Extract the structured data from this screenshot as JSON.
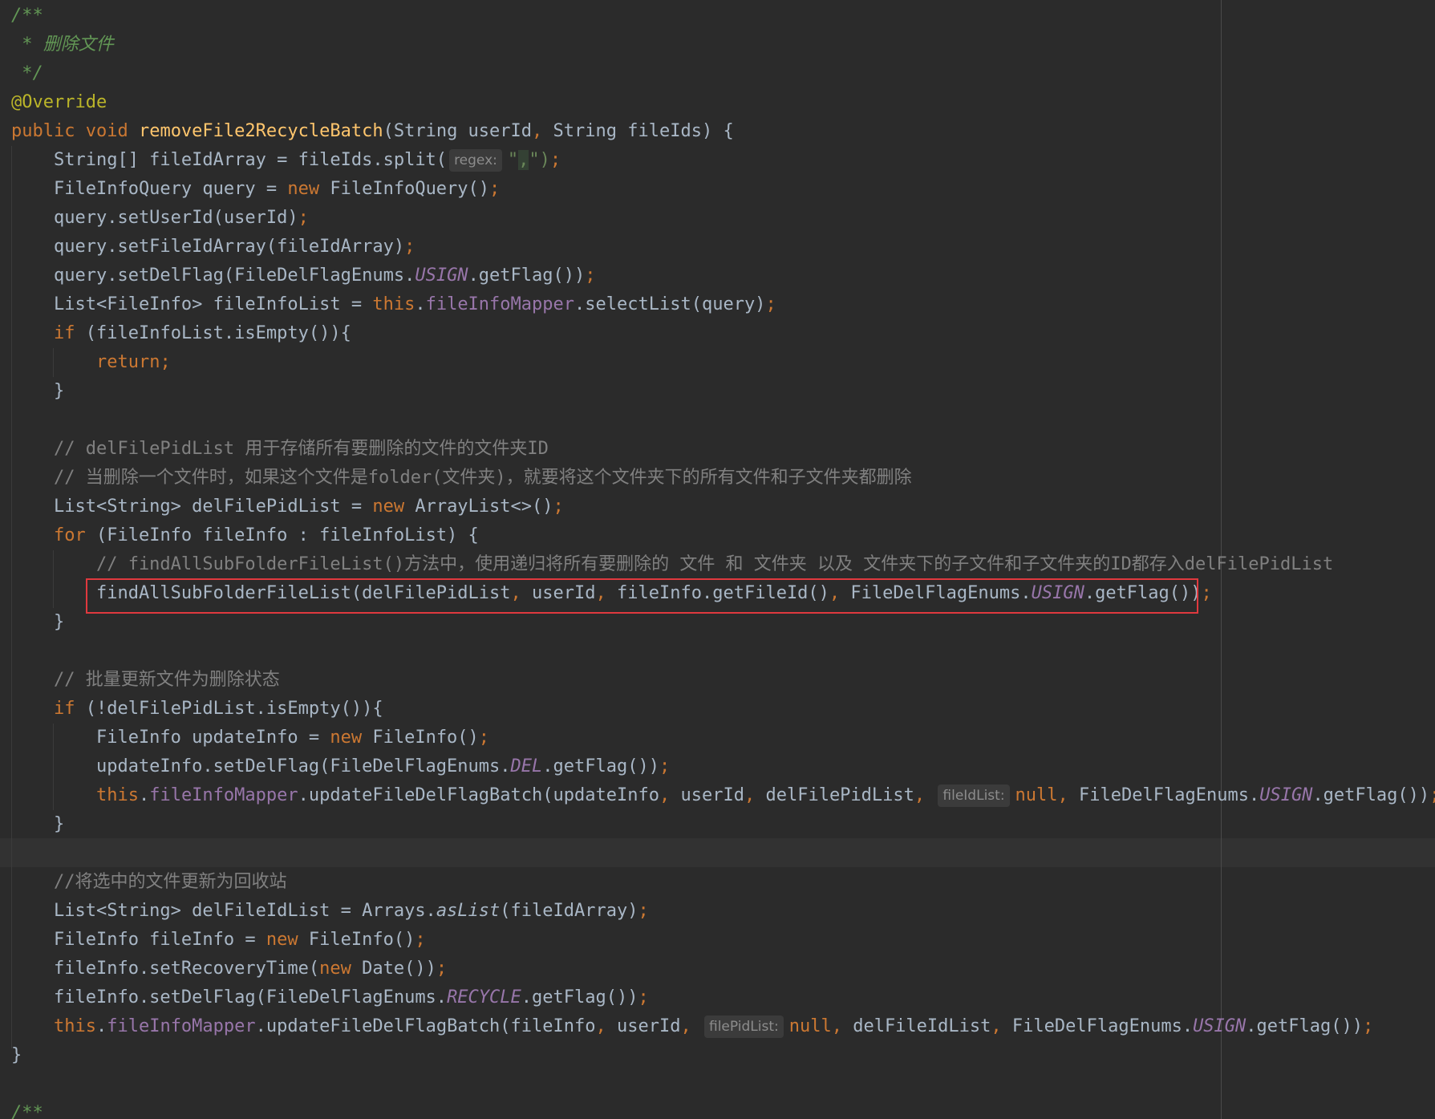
{
  "editor": {
    "highlighted_line_index": 20,
    "lines": [
      [
        {
          "t": "/**",
          "k": "doc"
        }
      ],
      [
        {
          "t": " * 删除文件",
          "k": "doc"
        }
      ],
      [
        {
          "t": " */",
          "k": "doc"
        }
      ],
      [
        {
          "t": "@Override",
          "k": "ann"
        }
      ],
      [
        {
          "t": "public void ",
          "k": "kw"
        },
        {
          "t": "removeFile2RecycleBatch",
          "k": "fn"
        },
        {
          "t": "(String userId",
          "k": "plain"
        },
        {
          "t": ", ",
          "k": "punct"
        },
        {
          "t": "String fileIds) {",
          "k": "plain"
        }
      ],
      [
        {
          "t": "    String[] fileIdArray = fileIds.split(",
          "k": "plain"
        },
        {
          "t": "regex:",
          "k": "hint"
        },
        {
          "t": "\"",
          "k": "str"
        },
        {
          "t": ",",
          "k": "str_hl"
        },
        {
          "t": "\")",
          "k": "str"
        },
        {
          "t": ";",
          "k": "punct"
        }
      ],
      [
        {
          "t": "    FileInfoQuery query = ",
          "k": "plain"
        },
        {
          "t": "new ",
          "k": "kw"
        },
        {
          "t": "FileInfoQuery()",
          "k": "plain"
        },
        {
          "t": ";",
          "k": "punct"
        }
      ],
      [
        {
          "t": "    query.setUserId(userId)",
          "k": "plain"
        },
        {
          "t": ";",
          "k": "punct"
        }
      ],
      [
        {
          "t": "    query.setFileIdArray(fileIdArray)",
          "k": "plain"
        },
        {
          "t": ";",
          "k": "punct"
        }
      ],
      [
        {
          "t": "    query.setDelFlag(FileDelFlagEnums.",
          "k": "plain"
        },
        {
          "t": "USIGN",
          "k": "const"
        },
        {
          "t": ".getFlag())",
          "k": "plain"
        },
        {
          "t": ";",
          "k": "punct"
        }
      ],
      [
        {
          "t": "    List<FileInfo> fileInfoList = ",
          "k": "plain"
        },
        {
          "t": "this",
          "k": "kw"
        },
        {
          "t": ".",
          "k": "plain"
        },
        {
          "t": "fileInfoMapper",
          "k": "field"
        },
        {
          "t": ".selectList(query)",
          "k": "plain"
        },
        {
          "t": ";",
          "k": "punct"
        }
      ],
      [
        {
          "t": "    ",
          "k": "plain"
        },
        {
          "t": "if ",
          "k": "kw"
        },
        {
          "t": "(fileInfoList.isEmpty()){",
          "k": "plain"
        }
      ],
      [
        {
          "t": "        ",
          "k": "plain"
        },
        {
          "t": "return;",
          "k": "kw"
        }
      ],
      [
        {
          "t": "    }",
          "k": "plain"
        }
      ],
      [
        {
          "t": "",
          "k": "plain"
        }
      ],
      [
        {
          "t": "    // delFilePidList 用于存储所有要删除的文件的文件夹ID",
          "k": "comment"
        }
      ],
      [
        {
          "t": "    // 当删除一个文件时，如果这个文件是folder(文件夹)，就要将这个文件夹下的所有文件和子文件夹都删除",
          "k": "comment"
        }
      ],
      [
        {
          "t": "    List<String> delFilePidList = ",
          "k": "plain"
        },
        {
          "t": "new ",
          "k": "kw"
        },
        {
          "t": "ArrayList<>()",
          "k": "plain"
        },
        {
          "t": ";",
          "k": "punct"
        }
      ],
      [
        {
          "t": "    ",
          "k": "plain"
        },
        {
          "t": "for ",
          "k": "kw"
        },
        {
          "t": "(FileInfo fileInfo : fileInfoList) {",
          "k": "plain"
        }
      ],
      [
        {
          "t": "        // findAllSubFolderFileList()方法中，使用递归将所有要删除的 文件 和 文件夹 以及 文件夹下的子文件和子文件夹的ID都存入delFilePidList",
          "k": "comment"
        }
      ],
      [
        {
          "t": "        findAllSubFolderFileList(delFilePidList",
          "k": "plain"
        },
        {
          "t": ", ",
          "k": "punct"
        },
        {
          "t": "userId",
          "k": "plain"
        },
        {
          "t": ", ",
          "k": "punct"
        },
        {
          "t": "fileInfo.getFileId()",
          "k": "plain"
        },
        {
          "t": ", ",
          "k": "punct"
        },
        {
          "t": "FileDelFlagEnums.",
          "k": "plain"
        },
        {
          "t": "USIGN",
          "k": "const"
        },
        {
          "t": ".getFlag())",
          "k": "plain"
        },
        {
          "t": ";",
          "k": "punct"
        }
      ],
      [
        {
          "t": "    }",
          "k": "plain"
        }
      ],
      [
        {
          "t": "",
          "k": "plain"
        }
      ],
      [
        {
          "t": "    // 批量更新文件为删除状态",
          "k": "comment"
        }
      ],
      [
        {
          "t": "    ",
          "k": "plain"
        },
        {
          "t": "if ",
          "k": "kw"
        },
        {
          "t": "(!delFilePidList.isEmpty()){",
          "k": "plain"
        }
      ],
      [
        {
          "t": "        FileInfo updateInfo = ",
          "k": "plain"
        },
        {
          "t": "new ",
          "k": "kw"
        },
        {
          "t": "FileInfo()",
          "k": "plain"
        },
        {
          "t": ";",
          "k": "punct"
        }
      ],
      [
        {
          "t": "        updateInfo.setDelFlag(FileDelFlagEnums.",
          "k": "plain"
        },
        {
          "t": "DEL",
          "k": "const"
        },
        {
          "t": ".getFlag())",
          "k": "plain"
        },
        {
          "t": ";",
          "k": "punct"
        }
      ],
      [
        {
          "t": "        ",
          "k": "plain"
        },
        {
          "t": "this",
          "k": "kw"
        },
        {
          "t": ".",
          "k": "plain"
        },
        {
          "t": "fileInfoMapper",
          "k": "field"
        },
        {
          "t": ".updateFileDelFlagBatch(updateInfo",
          "k": "plain"
        },
        {
          "t": ", ",
          "k": "punct"
        },
        {
          "t": "userId",
          "k": "plain"
        },
        {
          "t": ", ",
          "k": "punct"
        },
        {
          "t": "delFilePidList",
          "k": "plain"
        },
        {
          "t": ", ",
          "k": "punct"
        },
        {
          "t": "fileIdList:",
          "k": "hint"
        },
        {
          "t": "null",
          "k": "kw"
        },
        {
          "t": ", ",
          "k": "punct"
        },
        {
          "t": "FileDelFlagEnums.",
          "k": "plain"
        },
        {
          "t": "USIGN",
          "k": "const"
        },
        {
          "t": ".getFlag())",
          "k": "plain"
        },
        {
          "t": ";",
          "k": "punct"
        }
      ],
      [
        {
          "t": "    }",
          "k": "plain"
        }
      ],
      [
        {
          "t": "",
          "k": "plain"
        }
      ],
      [
        {
          "t": "    //将选中的文件更新为回收站",
          "k": "comment"
        }
      ],
      [
        {
          "t": "    List<String> delFileIdList = Arrays.",
          "k": "plain"
        },
        {
          "t": "asList",
          "k": "static"
        },
        {
          "t": "(fileIdArray)",
          "k": "plain"
        },
        {
          "t": ";",
          "k": "punct"
        }
      ],
      [
        {
          "t": "    FileInfo fileInfo = ",
          "k": "plain"
        },
        {
          "t": "new ",
          "k": "kw"
        },
        {
          "t": "FileInfo()",
          "k": "plain"
        },
        {
          "t": ";",
          "k": "punct"
        }
      ],
      [
        {
          "t": "    fileInfo.setRecoveryTime(",
          "k": "plain"
        },
        {
          "t": "new ",
          "k": "kw"
        },
        {
          "t": "Date())",
          "k": "plain"
        },
        {
          "t": ";",
          "k": "punct"
        }
      ],
      [
        {
          "t": "    fileInfo.setDelFlag(FileDelFlagEnums.",
          "k": "plain"
        },
        {
          "t": "RECYCLE",
          "k": "const"
        },
        {
          "t": ".getFlag())",
          "k": "plain"
        },
        {
          "t": ";",
          "k": "punct"
        }
      ],
      [
        {
          "t": "    ",
          "k": "plain"
        },
        {
          "t": "this",
          "k": "kw"
        },
        {
          "t": ".",
          "k": "plain"
        },
        {
          "t": "fileInfoMapper",
          "k": "field"
        },
        {
          "t": ".updateFileDelFlagBatch(fileInfo",
          "k": "plain"
        },
        {
          "t": ", ",
          "k": "punct"
        },
        {
          "t": "userId",
          "k": "plain"
        },
        {
          "t": ", ",
          "k": "punct"
        },
        {
          "t": "filePidList:",
          "k": "hint"
        },
        {
          "t": "null",
          "k": "kw"
        },
        {
          "t": ", ",
          "k": "punct"
        },
        {
          "t": "delFileIdList",
          "k": "plain"
        },
        {
          "t": ", ",
          "k": "punct"
        },
        {
          "t": "FileDelFlagEnums.",
          "k": "plain"
        },
        {
          "t": "USIGN",
          "k": "const"
        },
        {
          "t": ".getFlag())",
          "k": "plain"
        },
        {
          "t": ";",
          "k": "punct"
        }
      ],
      [
        {
          "t": "}",
          "k": "plain"
        }
      ],
      [
        {
          "t": "",
          "k": "plain"
        }
      ],
      [
        {
          "t": "/**",
          "k": "doc"
        }
      ]
    ]
  }
}
